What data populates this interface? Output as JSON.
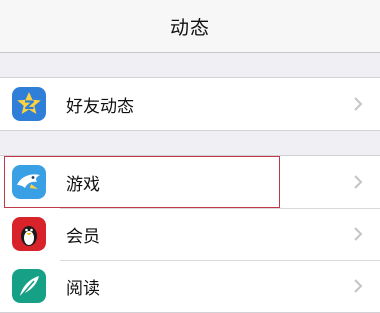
{
  "navbar": {
    "title": "动态"
  },
  "section1": {
    "items": [
      {
        "label": "好友动态",
        "icon": "qzone-star-icon"
      }
    ]
  },
  "section2": {
    "items": [
      {
        "label": "游戏",
        "icon": "game-shark-icon"
      },
      {
        "label": "会员",
        "icon": "vip-penguin-icon"
      },
      {
        "label": "阅读",
        "icon": "reading-feather-icon"
      }
    ]
  },
  "colors": {
    "navbar_bg": "#f7f7f8",
    "page_bg": "#efeff4",
    "highlight_border": "#c0394a",
    "qzone_blue": "#2f7ed8",
    "game_blue": "#3aa0e6",
    "vip_red": "#d8232a",
    "read_green": "#16a085"
  },
  "state": {
    "highlighted_item": "游戏"
  }
}
